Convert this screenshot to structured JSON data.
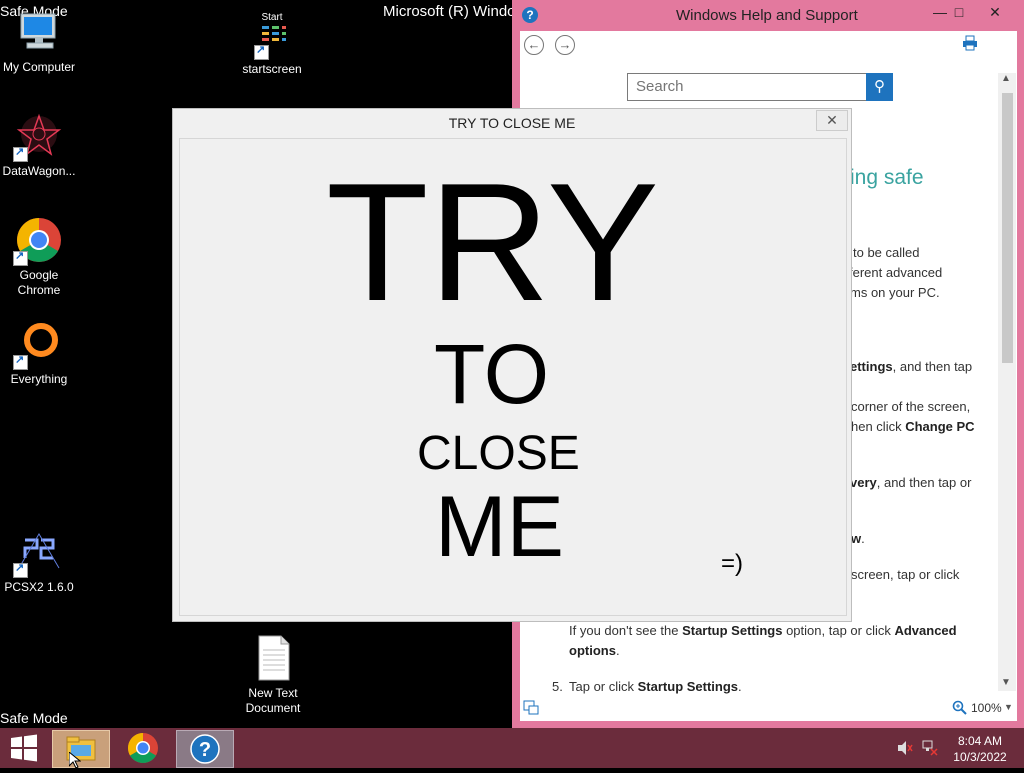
{
  "desktop": {
    "safe_mode_label": "Safe Mode",
    "os_title": "Microsoft (R) Windo",
    "icons": [
      {
        "label": "My Computer"
      },
      {
        "label": "DataWagon..."
      },
      {
        "label": "Google Chrome"
      },
      {
        "label": "Everything"
      },
      {
        "label": "PCSX2 1.6.0"
      },
      {
        "label": "startscreen",
        "top_label": "Start"
      },
      {
        "label": "New Text Document"
      }
    ]
  },
  "help_window": {
    "title": "Windows Help and Support",
    "search_placeholder": "Search",
    "heading_fragment": "ing safe",
    "zoom": "100%",
    "lines": [
      {
        "pre": "to be called",
        "bold": "",
        "post": ""
      },
      {
        "pre": "ferent advanced",
        "bold": "",
        "post": ""
      },
      {
        "pre": "ms on your PC.",
        "bold": "",
        "post": ""
      },
      {
        "pre": "",
        "bold": "ettings",
        "post": ", and then tap"
      },
      {
        "pre": "corner of the screen,",
        "bold": "",
        "post": ""
      },
      {
        "pre": "hen click ",
        "bold": "Change PC",
        "post": ""
      },
      {
        "pre": "",
        "bold": "very",
        "post": ", and then tap or"
      },
      {
        "pre": "",
        "bold": "w",
        "post": "."
      },
      {
        "pre": "screen, tap or click",
        "bold": "",
        "post": ""
      },
      {
        "pre": "If you don't see the ",
        "bold": "Startup Settings",
        "post": " option, tap or click "
      },
      {
        "pre": "",
        "bold": "Advanced",
        "post": ""
      },
      {
        "pre": "",
        "bold": "options",
        "post": "."
      },
      {
        "pre": "5.",
        "bold": "",
        "post": ""
      },
      {
        "pre": "Tap or click ",
        "bold": "Startup Settings",
        "post": "."
      }
    ]
  },
  "try_window": {
    "title": "TRY TO CLOSE ME",
    "close_glyph": "✕",
    "big_try": "TRY",
    "big_to": "TO",
    "big_close": "CLOSE",
    "big_me": "ME",
    "smiley": "=)"
  },
  "taskbar": {
    "time": "8:04 AM",
    "date": "10/3/2022"
  }
}
